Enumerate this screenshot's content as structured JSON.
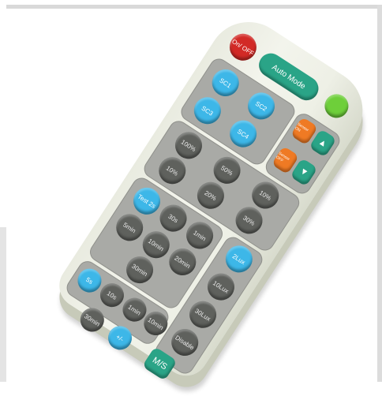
{
  "product": "IR remote control",
  "buttons": {
    "power": "On/ OFF",
    "auto_mode": "Auto Mode",
    "ch1": "SC1",
    "ch2": "SC2",
    "ch3": "SC3",
    "ch4": "SC4",
    "sensor_on": "Sensor ON",
    "sensor_off": "Sensor OFF",
    "up": "▲",
    "down": "▼",
    "row1": [
      "100%",
      "50%",
      "10%"
    ],
    "row2": [
      "10%",
      "20%",
      "30%"
    ],
    "test": "Test 2s",
    "hold_a": [
      "30s",
      "1min",
      "5min"
    ],
    "hold_b": [
      "10min",
      "20min",
      "30min"
    ],
    "light": [
      "2Lux",
      "10Lux",
      "30Lux",
      "Disable"
    ],
    "time_a": [
      "5s",
      "10s",
      "1min"
    ],
    "time_b": [
      "10min",
      "30min",
      "+/-"
    ],
    "ms": "M/S"
  },
  "colors": {
    "blue": "#3db7e8",
    "orange": "#ef7a24",
    "red": "#d22a26",
    "green": "#6ecf3a",
    "teal": "#2aa487",
    "dark": "#5f615d",
    "shell": "#eef0e6"
  }
}
